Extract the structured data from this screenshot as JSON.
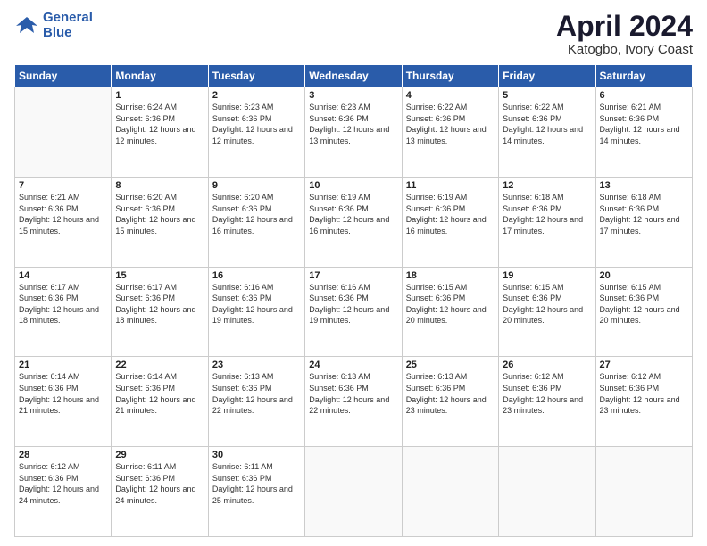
{
  "header": {
    "logo_line1": "General",
    "logo_line2": "Blue",
    "title": "April 2024",
    "subtitle": "Katogbo, Ivory Coast"
  },
  "days_of_week": [
    "Sunday",
    "Monday",
    "Tuesday",
    "Wednesday",
    "Thursday",
    "Friday",
    "Saturday"
  ],
  "weeks": [
    [
      {
        "day": "",
        "info": ""
      },
      {
        "day": "1",
        "info": "Sunrise: 6:24 AM\nSunset: 6:36 PM\nDaylight: 12 hours\nand 12 minutes."
      },
      {
        "day": "2",
        "info": "Sunrise: 6:23 AM\nSunset: 6:36 PM\nDaylight: 12 hours\nand 12 minutes."
      },
      {
        "day": "3",
        "info": "Sunrise: 6:23 AM\nSunset: 6:36 PM\nDaylight: 12 hours\nand 13 minutes."
      },
      {
        "day": "4",
        "info": "Sunrise: 6:22 AM\nSunset: 6:36 PM\nDaylight: 12 hours\nand 13 minutes."
      },
      {
        "day": "5",
        "info": "Sunrise: 6:22 AM\nSunset: 6:36 PM\nDaylight: 12 hours\nand 14 minutes."
      },
      {
        "day": "6",
        "info": "Sunrise: 6:21 AM\nSunset: 6:36 PM\nDaylight: 12 hours\nand 14 minutes."
      }
    ],
    [
      {
        "day": "7",
        "info": "Sunrise: 6:21 AM\nSunset: 6:36 PM\nDaylight: 12 hours\nand 15 minutes."
      },
      {
        "day": "8",
        "info": "Sunrise: 6:20 AM\nSunset: 6:36 PM\nDaylight: 12 hours\nand 15 minutes."
      },
      {
        "day": "9",
        "info": "Sunrise: 6:20 AM\nSunset: 6:36 PM\nDaylight: 12 hours\nand 16 minutes."
      },
      {
        "day": "10",
        "info": "Sunrise: 6:19 AM\nSunset: 6:36 PM\nDaylight: 12 hours\nand 16 minutes."
      },
      {
        "day": "11",
        "info": "Sunrise: 6:19 AM\nSunset: 6:36 PM\nDaylight: 12 hours\nand 16 minutes."
      },
      {
        "day": "12",
        "info": "Sunrise: 6:18 AM\nSunset: 6:36 PM\nDaylight: 12 hours\nand 17 minutes."
      },
      {
        "day": "13",
        "info": "Sunrise: 6:18 AM\nSunset: 6:36 PM\nDaylight: 12 hours\nand 17 minutes."
      }
    ],
    [
      {
        "day": "14",
        "info": "Sunrise: 6:17 AM\nSunset: 6:36 PM\nDaylight: 12 hours\nand 18 minutes."
      },
      {
        "day": "15",
        "info": "Sunrise: 6:17 AM\nSunset: 6:36 PM\nDaylight: 12 hours\nand 18 minutes."
      },
      {
        "day": "16",
        "info": "Sunrise: 6:16 AM\nSunset: 6:36 PM\nDaylight: 12 hours\nand 19 minutes."
      },
      {
        "day": "17",
        "info": "Sunrise: 6:16 AM\nSunset: 6:36 PM\nDaylight: 12 hours\nand 19 minutes."
      },
      {
        "day": "18",
        "info": "Sunrise: 6:15 AM\nSunset: 6:36 PM\nDaylight: 12 hours\nand 20 minutes."
      },
      {
        "day": "19",
        "info": "Sunrise: 6:15 AM\nSunset: 6:36 PM\nDaylight: 12 hours\nand 20 minutes."
      },
      {
        "day": "20",
        "info": "Sunrise: 6:15 AM\nSunset: 6:36 PM\nDaylight: 12 hours\nand 20 minutes."
      }
    ],
    [
      {
        "day": "21",
        "info": "Sunrise: 6:14 AM\nSunset: 6:36 PM\nDaylight: 12 hours\nand 21 minutes."
      },
      {
        "day": "22",
        "info": "Sunrise: 6:14 AM\nSunset: 6:36 PM\nDaylight: 12 hours\nand 21 minutes."
      },
      {
        "day": "23",
        "info": "Sunrise: 6:13 AM\nSunset: 6:36 PM\nDaylight: 12 hours\nand 22 minutes."
      },
      {
        "day": "24",
        "info": "Sunrise: 6:13 AM\nSunset: 6:36 PM\nDaylight: 12 hours\nand 22 minutes."
      },
      {
        "day": "25",
        "info": "Sunrise: 6:13 AM\nSunset: 6:36 PM\nDaylight: 12 hours\nand 23 minutes."
      },
      {
        "day": "26",
        "info": "Sunrise: 6:12 AM\nSunset: 6:36 PM\nDaylight: 12 hours\nand 23 minutes."
      },
      {
        "day": "27",
        "info": "Sunrise: 6:12 AM\nSunset: 6:36 PM\nDaylight: 12 hours\nand 23 minutes."
      }
    ],
    [
      {
        "day": "28",
        "info": "Sunrise: 6:12 AM\nSunset: 6:36 PM\nDaylight: 12 hours\nand 24 minutes."
      },
      {
        "day": "29",
        "info": "Sunrise: 6:11 AM\nSunset: 6:36 PM\nDaylight: 12 hours\nand 24 minutes."
      },
      {
        "day": "30",
        "info": "Sunrise: 6:11 AM\nSunset: 6:36 PM\nDaylight: 12 hours\nand 25 minutes."
      },
      {
        "day": "",
        "info": ""
      },
      {
        "day": "",
        "info": ""
      },
      {
        "day": "",
        "info": ""
      },
      {
        "day": "",
        "info": ""
      }
    ]
  ]
}
